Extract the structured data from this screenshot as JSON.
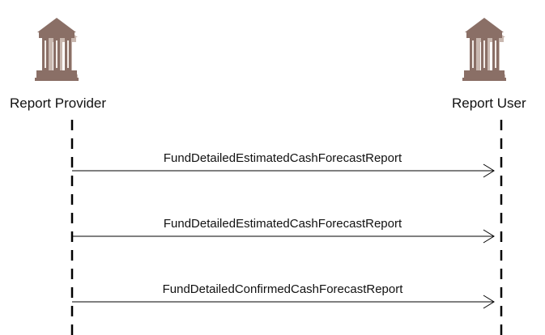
{
  "actors": [
    {
      "label": "Report Provider",
      "icon": "institution-building-icon"
    },
    {
      "label": "Report User",
      "icon": "institution-building-icon"
    }
  ],
  "messages": [
    {
      "label": "FundDetailedEstimatedCashForecastReport",
      "from": "Report Provider",
      "to": "Report User"
    },
    {
      "label": "FundDetailedEstimatedCashForecastReport",
      "from": "Report Provider",
      "to": "Report User"
    },
    {
      "label": "FundDetailedConfirmedCashForecastReport",
      "from": "Report Provider",
      "to": "Report User"
    }
  ],
  "colors": {
    "icon_fill": "#8a6f66",
    "icon_shadow": "#c9b8b0",
    "line": "#000000",
    "background": "#ffffff"
  }
}
